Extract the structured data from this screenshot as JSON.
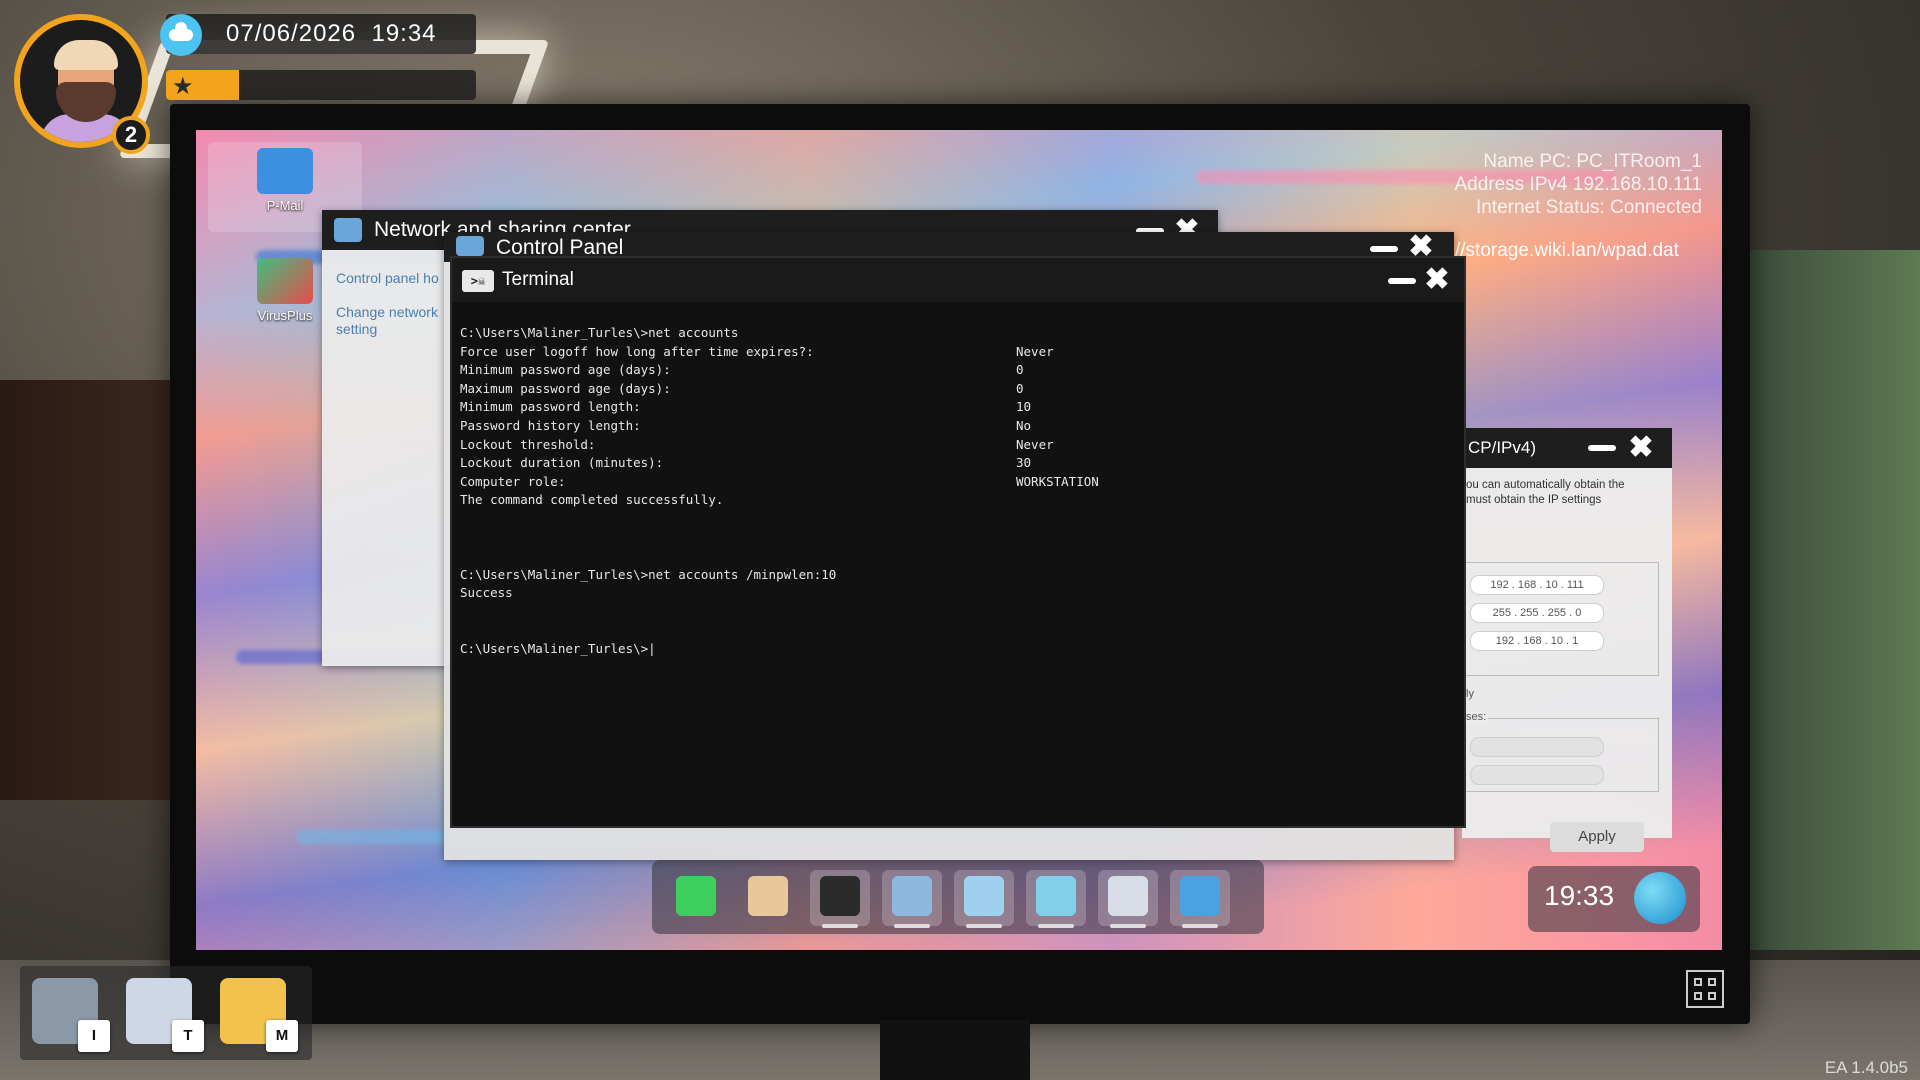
{
  "hud": {
    "date": "07/06/2026",
    "time": "19:34",
    "level": "2",
    "xp_fraction": 0.14,
    "weather_icon": "partly-cloudy-icon",
    "accent_color": "#f2a51c"
  },
  "desktop": {
    "icons": [
      {
        "label": "P-Mail",
        "icon": "mail-icon"
      },
      {
        "label": "VirusPlus",
        "icon": "virusplus-icon"
      }
    ],
    "info": {
      "pc_name": "Name PC: PC_ITRoom_1",
      "ip": "Address IPv4 192.168.10.111",
      "internet": "Internet Status: Connected"
    },
    "url": "//storage.wiki.lan/wpad.dat"
  },
  "windows": {
    "network": {
      "title": "Network and sharing center",
      "links": [
        "Control panel ho",
        "Change network setting"
      ]
    },
    "control_panel": {
      "title": "Control Panel"
    },
    "ipv4": {
      "title": "CP/IPv4)",
      "desc_line1": "ou can automatically obtain the",
      "desc_line2": "must obtain the IP settings",
      "ip": "192 . 168 . 10 . 111",
      "mask": "255 . 255 . 255 . 0",
      "gateway": "192 . 168 . 10 . 1",
      "fragment1": "ly",
      "fragment2": "ses:",
      "apply": "Apply"
    },
    "terminal": {
      "title": "Terminal",
      "icon_text": ">☠",
      "lines": [
        {
          "text": "C:\\Users\\Maliner_Turles\\>net accounts",
          "value": ""
        },
        {
          "text": "Force user logoff how long after time expires?:",
          "value": "Never"
        },
        {
          "text": "Minimum password age (days):",
          "value": "0"
        },
        {
          "text": "Maximum password age (days):",
          "value": "0"
        },
        {
          "text": "Minimum password length:",
          "value": "10"
        },
        {
          "text": "Password history length:",
          "value": "No"
        },
        {
          "text": "Lockout threshold:",
          "value": "Never"
        },
        {
          "text": "Lockout duration (minutes):",
          "value": "30"
        },
        {
          "text": "Computer role:",
          "value": "WORKSTATION"
        },
        {
          "text": "The command completed successfully.",
          "value": ""
        },
        {
          "text": "",
          "value": ""
        },
        {
          "text": "",
          "value": ""
        },
        {
          "text": "",
          "value": ""
        },
        {
          "text": "C:\\Users\\Maliner_Turles\\>net accounts /minpwlen:10",
          "value": ""
        },
        {
          "text": "Success",
          "value": ""
        },
        {
          "text": "",
          "value": ""
        },
        {
          "text": "",
          "value": ""
        },
        {
          "text": "C:\\Users\\Maliner_Turles\\>|",
          "value": ""
        }
      ]
    }
  },
  "taskbar": {
    "items": [
      {
        "name": "start-icon",
        "color": "#3fcf5e"
      },
      {
        "name": "file-manager-icon",
        "color": "#e8c89a"
      },
      {
        "name": "terminal-icon",
        "color": "#2b2b2b"
      },
      {
        "name": "control-panel-icon",
        "color": "#8fb8e0"
      },
      {
        "name": "network-center-icon",
        "color": "#9fd0f0"
      },
      {
        "name": "browser-icon",
        "color": "#7fd0e8"
      },
      {
        "name": "network-device-icon",
        "color": "#d8dde8"
      },
      {
        "name": "security-shield-icon",
        "color": "#4aa3e0"
      }
    ],
    "clock": "19:33"
  },
  "inventory": {
    "items": [
      {
        "name": "backpack-icon",
        "key": "I"
      },
      {
        "name": "tablet-icon",
        "key": "T"
      },
      {
        "name": "map-icon",
        "key": "M"
      }
    ]
  },
  "version": "EA 1.4.0b5"
}
